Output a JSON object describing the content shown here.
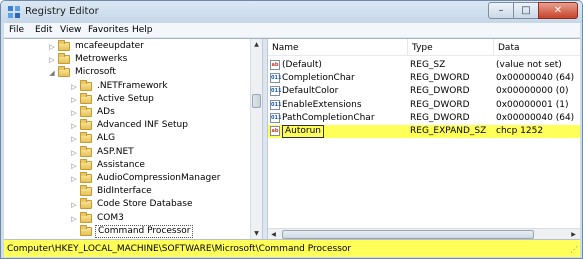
{
  "window": {
    "title": "Registry Editor",
    "controls": {
      "minimize": "–",
      "maximize": "□",
      "close": "✕"
    }
  },
  "menu": [
    "File",
    "Edit",
    "View",
    "Favorites",
    "Help"
  ],
  "tree": {
    "items": [
      {
        "label": "mcafeeupdater",
        "expander": "collapsed"
      },
      {
        "label": "Metrowerks",
        "expander": "collapsed"
      },
      {
        "label": "Microsoft",
        "expander": "expanded"
      },
      {
        "label": ".NETFramework",
        "expander": "collapsed"
      },
      {
        "label": "Active Setup",
        "expander": "collapsed"
      },
      {
        "label": "ADs",
        "expander": "collapsed"
      },
      {
        "label": "Advanced INF Setup",
        "expander": "collapsed"
      },
      {
        "label": "ALG",
        "expander": "collapsed"
      },
      {
        "label": "ASP.NET",
        "expander": "collapsed"
      },
      {
        "label": "Assistance",
        "expander": "collapsed"
      },
      {
        "label": "AudioCompressionManager",
        "expander": "collapsed"
      },
      {
        "label": "BidInterface",
        "expander": "none"
      },
      {
        "label": "Code Store Database",
        "expander": "collapsed"
      },
      {
        "label": "COM3",
        "expander": "collapsed"
      },
      {
        "label": "Command Processor",
        "expander": "none",
        "selected": true
      }
    ]
  },
  "list": {
    "columns": {
      "name": "Name",
      "type": "Type",
      "data": "Data"
    },
    "rows": [
      {
        "name": "(Default)",
        "type": "REG_SZ",
        "data": "(value not set)",
        "icon": "string-value-icon"
      },
      {
        "name": "CompletionChar",
        "type": "REG_DWORD",
        "data": "0x00000040 (64)",
        "icon": "binary-value-icon"
      },
      {
        "name": "DefaultColor",
        "type": "REG_DWORD",
        "data": "0x00000000 (0)",
        "icon": "binary-value-icon"
      },
      {
        "name": "EnableExtensions",
        "type": "REG_DWORD",
        "data": "0x00000001 (1)",
        "icon": "binary-value-icon"
      },
      {
        "name": "PathCompletionChar",
        "type": "REG_DWORD",
        "data": "0x00000040 (64)",
        "icon": "binary-value-icon"
      },
      {
        "name": "Autorun",
        "type": "REG_EXPAND_SZ",
        "data": "chcp 1252",
        "icon": "string-value-icon",
        "highlighted": true
      }
    ]
  },
  "statusbar": {
    "path": "Computer\\HKEY_LOCAL_MACHINE\\SOFTWARE\\Microsoft\\Command Processor"
  },
  "colors": {
    "highlight": "#ffff5a",
    "titlebar": "#c6d7e8",
    "folder": "#e5c25a"
  }
}
